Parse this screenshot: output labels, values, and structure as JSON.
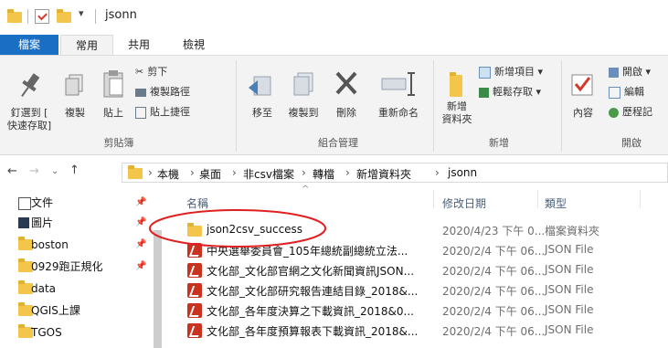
{
  "window": {
    "title": "jsonn"
  },
  "tabs": [
    {
      "label": "檔案"
    },
    {
      "label": "常用"
    },
    {
      "label": "共用"
    },
    {
      "label": "檢視"
    }
  ],
  "ribbon": {
    "pin_label_1": "釘選到 [",
    "pin_label_2": "快速存取]",
    "copy": "複製",
    "paste": "貼上",
    "cut": "剪下",
    "copy_path": "複製路徑",
    "paste_shortcut": "貼上捷徑",
    "move_to": "移至",
    "copy_to": "複製到",
    "delete": "刪除",
    "rename": "重新命名",
    "new_folder_1": "新增",
    "new_folder_2": "資料夾",
    "new_item": "新增項目 ▾",
    "easy_access": "輕鬆存取 ▾",
    "properties": "內容",
    "open": "開啟 ▾",
    "edit": "編輯",
    "history": "歷程記",
    "groups": {
      "clipboard": "剪貼簿",
      "organize": "組合管理",
      "new": "新增",
      "open": "開啟"
    }
  },
  "address": {
    "crumbs": [
      "本機",
      "桌面",
      "非csv檔案",
      "轉檔",
      "新增資料夾",
      "jsonn"
    ]
  },
  "nav": {
    "items": [
      {
        "label": "文件",
        "pinned": true
      },
      {
        "label": "圖片",
        "pinned": true
      },
      {
        "label": "boston",
        "pinned": true
      },
      {
        "label": "0929跑正規化",
        "pinned": true
      },
      {
        "label": "data",
        "pinned": false
      },
      {
        "label": "QGIS上課",
        "pinned": false
      },
      {
        "label": "TGOS",
        "pinned": false
      }
    ],
    "pin_glyph": "📌"
  },
  "columns": {
    "name": "名稱",
    "modified": "修改日期",
    "type": "類型"
  },
  "files": [
    {
      "name": "json2csv_success",
      "date": "2020/4/23 下午 0...",
      "type": "檔案資料夾",
      "kind": "folder"
    },
    {
      "name": "中央選舉委員會_105年總統副總統立法...",
      "date": "2020/2/4 下午 06...",
      "type": "JSON File",
      "kind": "json"
    },
    {
      "name": "文化部_文化部官網之文化新聞資訊JSON...",
      "date": "2020/2/4 下午 06...",
      "type": "JSON File",
      "kind": "json"
    },
    {
      "name": "文化部_文化部研究報告連結目錄_2018&...",
      "date": "2020/2/4 下午 06...",
      "type": "JSON File",
      "kind": "json"
    },
    {
      "name": "文化部_各年度決算之下載資訊_2018&0...",
      "date": "2020/2/4 下午 06...",
      "type": "JSON File",
      "kind": "json"
    },
    {
      "name": "文化部_各年度預算報表下載資訊_2018&...",
      "date": "2020/2/4 下午 06...",
      "type": "JSON File",
      "kind": "json"
    }
  ],
  "colors": {
    "accent": "#1a6fc4",
    "highlight_circle": "#e02020",
    "folder": "#f3c64b",
    "json_icon": "#c8321f"
  }
}
